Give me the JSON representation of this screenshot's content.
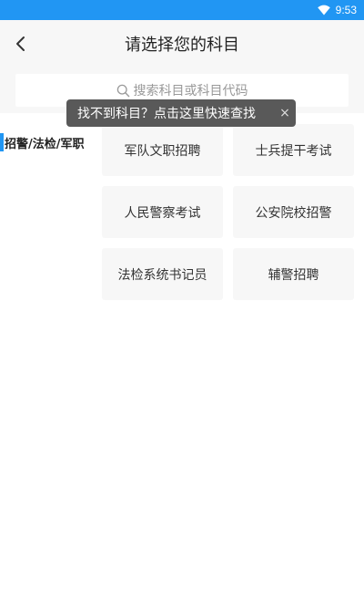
{
  "status_bar": {
    "time": "9:53",
    "background": "#2196f3"
  },
  "header": {
    "back_icon": "chevron-left-icon",
    "title": "请选择您的科目"
  },
  "search": {
    "icon": "search-icon",
    "placeholder": "搜索科目或科目代码"
  },
  "tooltip": {
    "text": "找不到科目？点击这里快速查找",
    "close_label": "×"
  },
  "sidebar": {
    "items": [
      {
        "label": "招警/法检/军职",
        "selected": true
      }
    ],
    "accent": "#2196f3"
  },
  "subjects": [
    "军队文职招聘",
    "士兵提干考试",
    "人民警察考试",
    "公安院校招警",
    "法检系统书记员",
    "辅警招聘"
  ]
}
